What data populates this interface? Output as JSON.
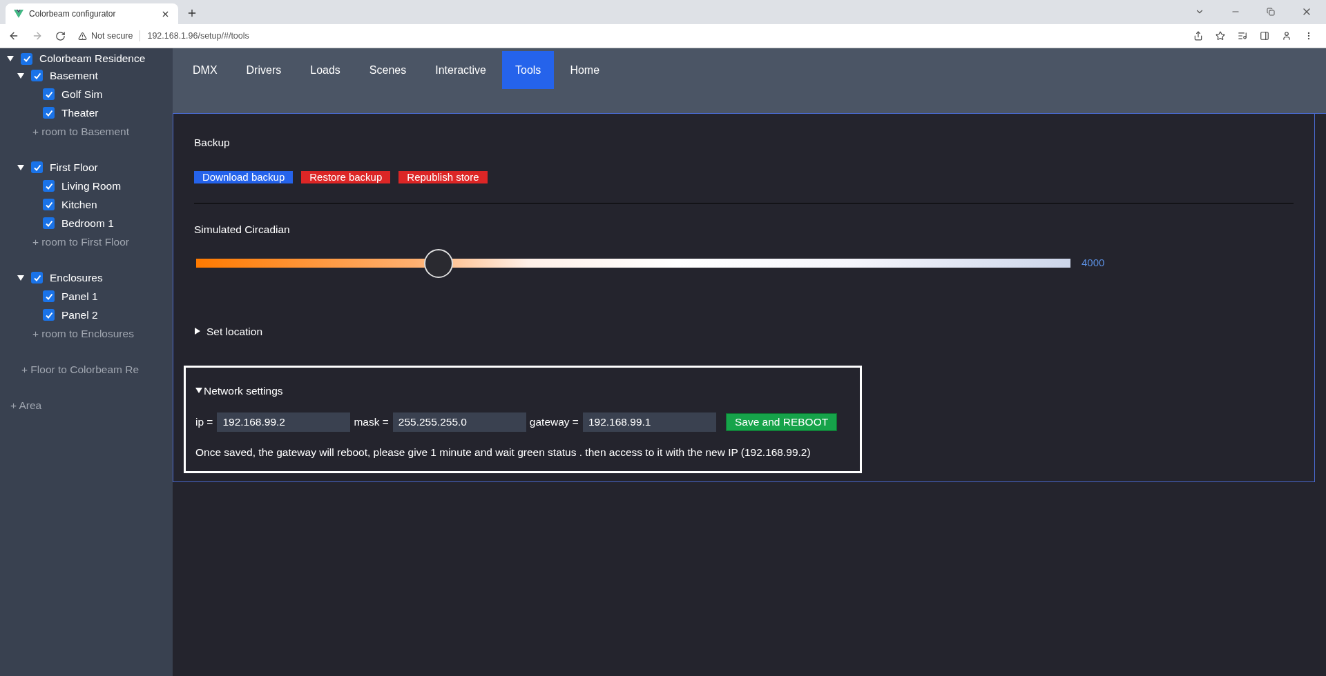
{
  "browser": {
    "tab_title": "Colorbeam configurator",
    "security": "Not secure",
    "url": "192.168.1.96/setup/#/tools"
  },
  "sidebar": {
    "tree": [
      {
        "label": "Colorbeam Residence",
        "checked": true,
        "expanded": true,
        "children": [
          {
            "label": "Basement",
            "checked": true,
            "expanded": true,
            "children": [
              {
                "label": "Golf Sim",
                "checked": true
              },
              {
                "label": "Theater",
                "checked": true
              }
            ],
            "add_link": "+ room to Basement"
          },
          {
            "label": "First Floor",
            "checked": true,
            "expanded": true,
            "children": [
              {
                "label": "Living Room",
                "checked": true
              },
              {
                "label": "Kitchen",
                "checked": true
              },
              {
                "label": "Bedroom 1",
                "checked": true
              }
            ],
            "add_link": "+ room to First Floor"
          },
          {
            "label": "Enclosures",
            "checked": true,
            "expanded": true,
            "children": [
              {
                "label": "Panel 1",
                "checked": true
              },
              {
                "label": "Panel 2",
                "checked": true
              }
            ],
            "add_link": "+ room to Enclosures"
          }
        ],
        "add_link": "+ Floor to Colorbeam Re"
      }
    ],
    "add_area_link": "+ Area"
  },
  "tabs": [
    {
      "label": "DMX",
      "selected": false
    },
    {
      "label": "Drivers",
      "selected": false
    },
    {
      "label": "Loads",
      "selected": false
    },
    {
      "label": "Scenes",
      "selected": false
    },
    {
      "label": "Interactive",
      "selected": false
    },
    {
      "label": "Tools",
      "selected": true
    },
    {
      "label": "Home",
      "selected": false
    }
  ],
  "backup": {
    "title": "Backup",
    "buttons": [
      {
        "label": "Download backup",
        "kind": "primary"
      },
      {
        "label": "Restore backup",
        "kind": "danger"
      },
      {
        "label": "Republish store",
        "kind": "danger"
      }
    ]
  },
  "circadian": {
    "title": "Simulated Circadian",
    "level": 0.277,
    "reading": "4000"
  },
  "set_location": {
    "label": "Set location",
    "expanded": false
  },
  "network": {
    "label": "Network settings",
    "expanded": true,
    "fields": [
      {
        "label": "ip =",
        "value": "192.168.99.2"
      },
      {
        "label": "mask =",
        "value": "255.255.255.0"
      },
      {
        "label": "gateway =",
        "value": "192.168.99.1"
      }
    ],
    "save_button": "Save and REBOOT",
    "note": "Once saved, the gateway will reboot, please give 1 minute and wait green status . then access to it with the new IP (192.168.99.2)"
  }
}
